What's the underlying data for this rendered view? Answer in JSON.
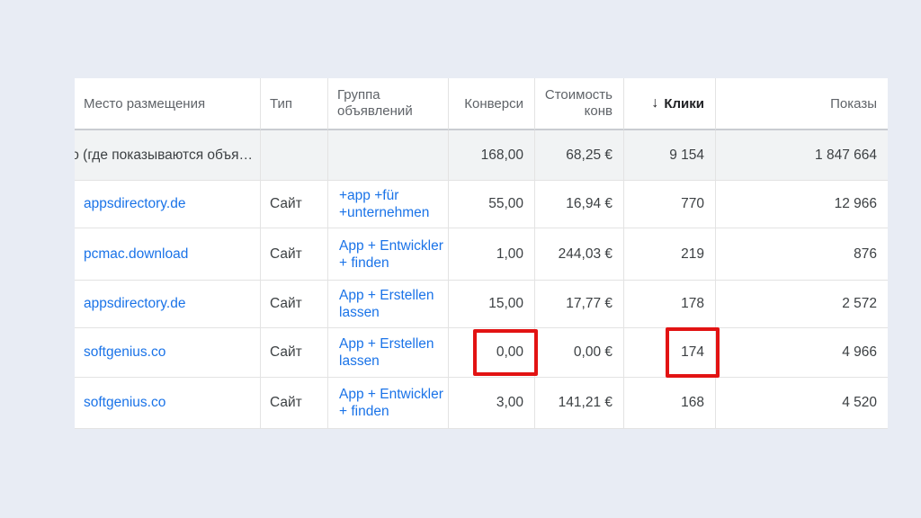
{
  "headers": {
    "placement": "Место размещения",
    "type": "Тип",
    "ad_group": "Группа объявлений",
    "conversions": "Конверси",
    "cost_per_conv_line1": "Стоимость",
    "cost_per_conv_line2": "конв",
    "clicks_arrow": "↓",
    "clicks": "Клики",
    "impressions": "Показы"
  },
  "total_row": {
    "placement": "о (где показываются объя…",
    "type": "",
    "ad_group": "",
    "conversions": "168,00",
    "cost_per_conv": "68,25 €",
    "clicks": "9 154",
    "impressions": "1 847 664"
  },
  "rows": [
    {
      "placement": "appsdirectory.de",
      "type": "Сайт",
      "ad_group": "+app +für +unternehmen",
      "conversions": "55,00",
      "cost_per_conv": "16,94 €",
      "clicks": "770",
      "impressions": "12 966"
    },
    {
      "placement": "pcmac.download",
      "type": "Сайт",
      "ad_group": "App + Entwickler + finden",
      "conversions": "1,00",
      "cost_per_conv": "244,03 €",
      "clicks": "219",
      "impressions": "876"
    },
    {
      "placement": "appsdirectory.de",
      "type": "Сайт",
      "ad_group": "App + Erstellen lassen",
      "conversions": "15,00",
      "cost_per_conv": "17,77 €",
      "clicks": "178",
      "impressions": "2 572"
    },
    {
      "placement": "softgenius.co",
      "type": "Сайт",
      "ad_group": "App + Erstellen lassen",
      "conversions": "0,00",
      "cost_per_conv": "0,00 €",
      "clicks": "174",
      "impressions": "4 966"
    },
    {
      "placement": "softgenius.co",
      "type": "Сайт",
      "ad_group": "App + Entwickler + finden",
      "conversions": "3,00",
      "cost_per_conv": "141,21 €",
      "clicks": "168",
      "impressions": "4 520"
    }
  ],
  "colors": {
    "link": "#1a73e8",
    "highlight": "#e21313",
    "total_row_bg": "#f1f3f4",
    "page_bg": "#e8ecf4"
  }
}
